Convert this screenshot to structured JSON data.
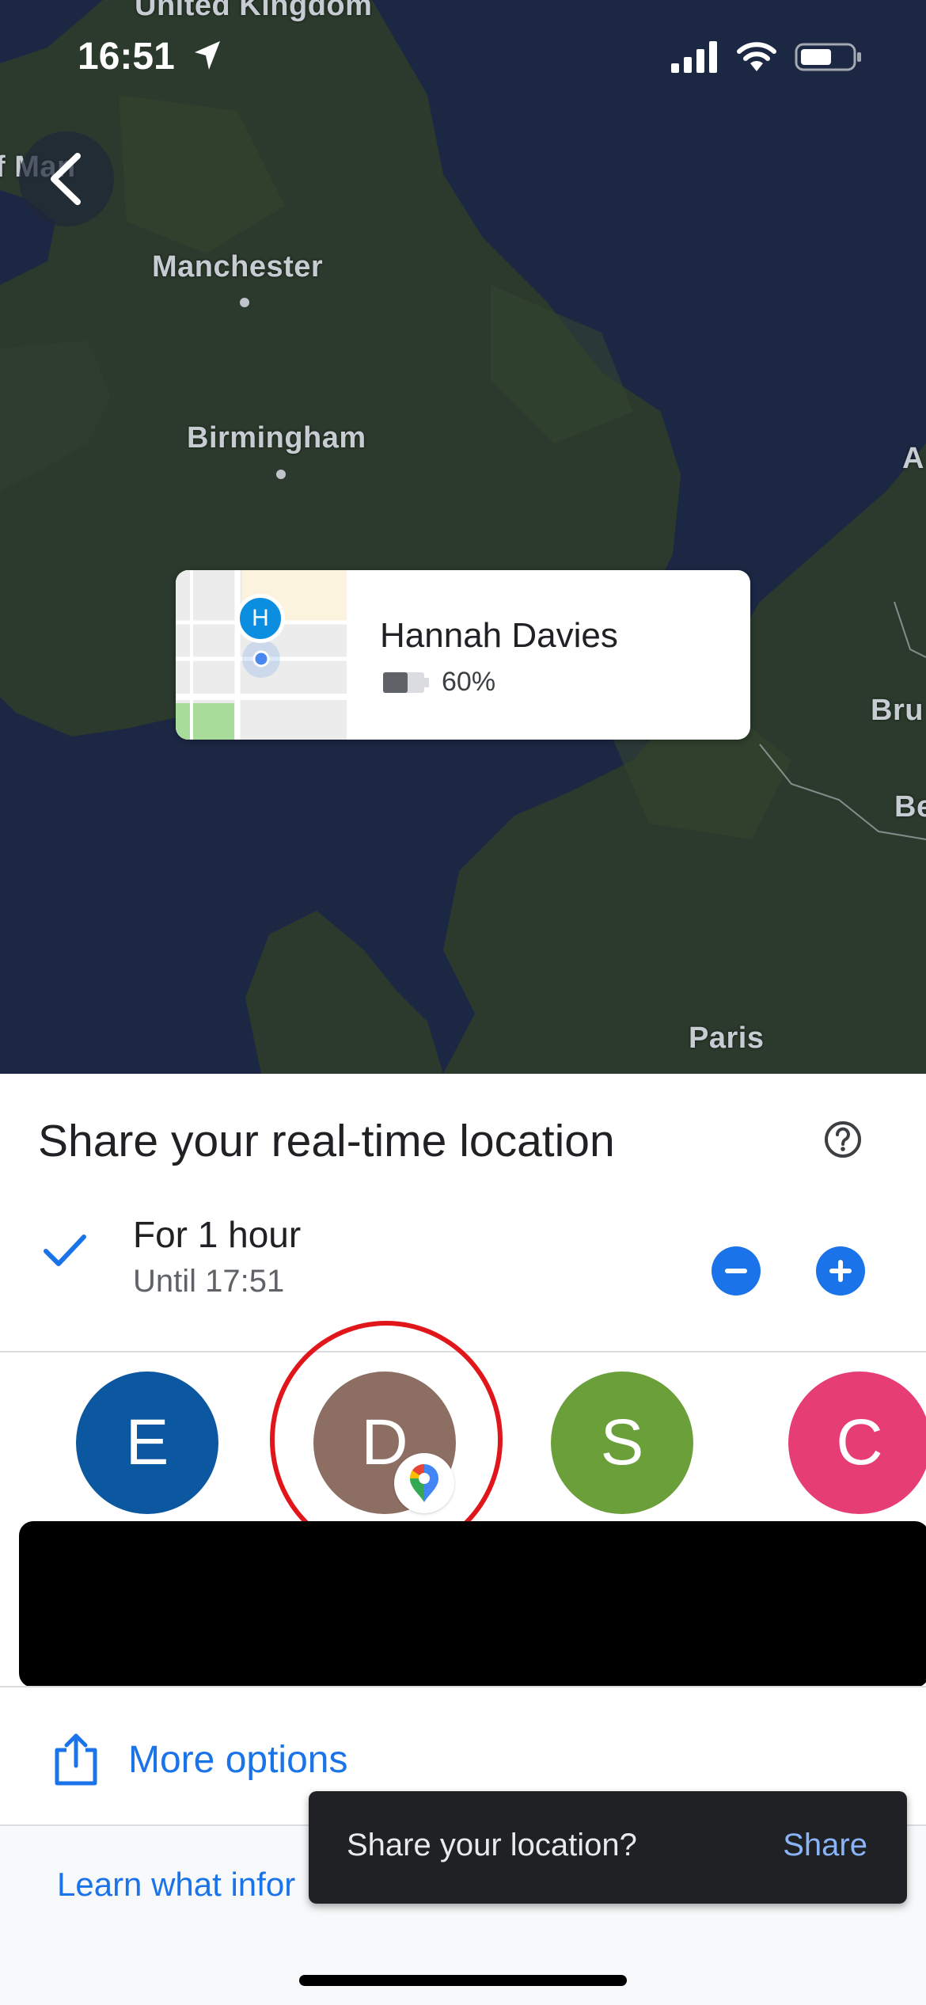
{
  "status_bar": {
    "time": "16:51",
    "icons": [
      "location-arrow-icon",
      "cellular-signal-icon",
      "wifi-icon",
      "battery-icon"
    ]
  },
  "map": {
    "labels": {
      "united_kingdom": "United Kingdom",
      "isle_of_man": "f Man",
      "manchester": "Manchester",
      "birmingham": "Birmingham",
      "brussels_partial": "Bru",
      "belgium_partial": "Be",
      "amsterdam_partial": "A",
      "paris": "Paris"
    },
    "back_icon": "chevron-left-icon"
  },
  "location_card": {
    "avatar_initial": "H",
    "name": "Hannah Davies",
    "battery": "60%",
    "battery_level": 0.6
  },
  "sheet": {
    "title": "Share your real-time location",
    "help_icon": "help-circle-icon",
    "duration": {
      "title": "For 1 hour",
      "subtitle": "Until 17:51"
    },
    "contacts": [
      {
        "initial": "E",
        "color": "#0b57a0"
      },
      {
        "initial": "D",
        "color": "#8d6e63"
      },
      {
        "initial": "S",
        "color": "#6a9f3a"
      },
      {
        "initial": "C",
        "color": "#e63e74"
      }
    ],
    "more_options": "More options",
    "learn_link": "Learn what infor"
  },
  "toast": {
    "message": "Share your location?",
    "action": "Share"
  },
  "colors": {
    "accent": "#1a73e8",
    "highlight": "#e0161b",
    "map_water": "#1c2743",
    "map_land": "#2b3a2c"
  }
}
